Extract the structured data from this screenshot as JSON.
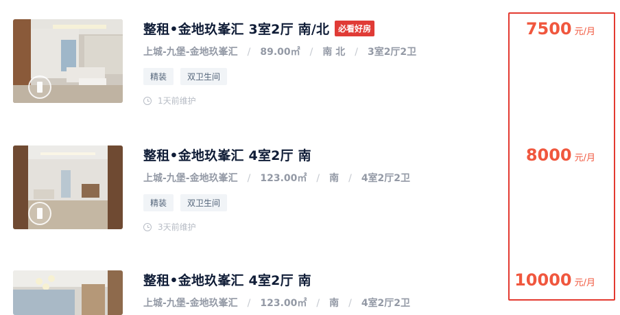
{
  "listings": [
    {
      "title": "整租•金地玖峯汇 3室2厅 南/北",
      "badge": "必看好房",
      "location": "上城-九堡-金地玖峯汇",
      "area": "89.00㎡",
      "orientation": "南 北",
      "layout": "3室2厅2卫",
      "tags": [
        "精装",
        "双卫生间"
      ],
      "maintained": "1天前维护",
      "price": "7500",
      "price_unit": "元/月"
    },
    {
      "title": "整租•金地玖峯汇 4室2厅 南",
      "badge": "",
      "location": "上城-九堡-金地玖峯汇",
      "area": "123.00㎡",
      "orientation": "南",
      "layout": "4室2厅2卫",
      "tags": [
        "精装",
        "双卫生间"
      ],
      "maintained": "3天前维护",
      "price": "8000",
      "price_unit": "元/月"
    },
    {
      "title": "整租•金地玖峯汇 4室2厅 南",
      "badge": "",
      "location": "上城-九堡-金地玖峯汇",
      "area": "123.00㎡",
      "orientation": "南",
      "layout": "4室2厅2卫",
      "tags": [],
      "maintained": "",
      "price": "10000",
      "price_unit": "元/月"
    }
  ],
  "colors": {
    "price": "#f0573e",
    "badge": "#e03b36",
    "highlight_box": "#e3392f",
    "title": "#101d37"
  },
  "icons": {
    "maintained": "clock-icon",
    "thumbnail_overlay": "vr-view-icon"
  }
}
